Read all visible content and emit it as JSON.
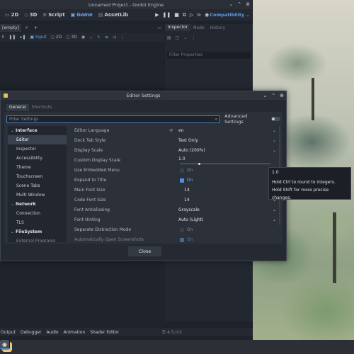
{
  "godot": {
    "window_title": "Unnamed Project - Godot Engine",
    "workspaces": [
      {
        "label": "2D",
        "icon": "2d-icon"
      },
      {
        "label": "3D",
        "icon": "3d-icon"
      },
      {
        "label": "Script",
        "icon": "script-icon"
      },
      {
        "label": "Game",
        "icon": "game-icon"
      },
      {
        "label": "AssetLib",
        "icon": "assetlib-icon"
      }
    ],
    "active_workspace": "Game",
    "renderer": "Compatibility",
    "scene_tab": "[empty]",
    "view_toolbar": {
      "input": "Input",
      "two_d": "2D",
      "three_d": "3D"
    },
    "inspector_tabs": [
      "Inspector",
      "Node",
      "History"
    ],
    "inspector_filter_placeholder": "Filter Properties",
    "bottom_panels": [
      "Output",
      "Debugger",
      "Audio",
      "Animation",
      "Shader Editor"
    ],
    "version": "4.5.rc2"
  },
  "dialog": {
    "title": "Editor Settings",
    "tabs": [
      "General",
      "Shortcuts"
    ],
    "filter_placeholder": "Filter Settings",
    "advanced_label": "Advanced Settings",
    "close_label": "Close",
    "tree": [
      {
        "label": "Interface",
        "section": true
      },
      {
        "label": "Editor",
        "selected": true
      },
      {
        "label": "Inspector"
      },
      {
        "label": "Accessibility"
      },
      {
        "label": "Theme"
      },
      {
        "label": "Touchscreen"
      },
      {
        "label": "Scene Tabs"
      },
      {
        "label": "Multi Window"
      },
      {
        "label": "Network",
        "section": true
      },
      {
        "label": "Connection"
      },
      {
        "label": "TLS"
      },
      {
        "label": "FileSystem",
        "section": true
      },
      {
        "label": "External Programs"
      }
    ],
    "properties": [
      {
        "label": "Editor Language",
        "value": "en",
        "kind": "dropdown",
        "revert": true
      },
      {
        "label": "Dock Tab Style",
        "value": "Text Only",
        "kind": "dropdown"
      },
      {
        "label": "Display Scale",
        "value": "Auto (200%)",
        "kind": "dropdown"
      },
      {
        "label": "Custom Display Scale",
        "value": "1.0",
        "kind": "slider"
      },
      {
        "label": "Use Embedded Menu",
        "value": "On",
        "kind": "checkbox",
        "checked": false
      },
      {
        "label": "Expand to Title",
        "value": "On",
        "kind": "checkbox",
        "checked": true
      },
      {
        "label": "Main Font Size",
        "value": "14",
        "kind": "spin"
      },
      {
        "label": "Code Font Size",
        "value": "14",
        "kind": "spin"
      },
      {
        "label": "Font Antialiasing",
        "value": "Grayscale",
        "kind": "dropdown"
      },
      {
        "label": "Font Hinting",
        "value": "Auto (Light)",
        "kind": "dropdown"
      },
      {
        "label": "Separate Distraction Mode",
        "value": "On",
        "kind": "checkbox",
        "checked": false
      },
      {
        "label": "Automatically Open Screenshots",
        "value": "On",
        "kind": "checkbox",
        "checked": true
      }
    ]
  },
  "tooltip": {
    "value": "1.0",
    "line1": "Hold Ctrl to round to integers.",
    "line2": "Hold Shift for more precise changes."
  },
  "colors": {
    "accent": "#5a9cf0",
    "selection": "#3a4250"
  }
}
